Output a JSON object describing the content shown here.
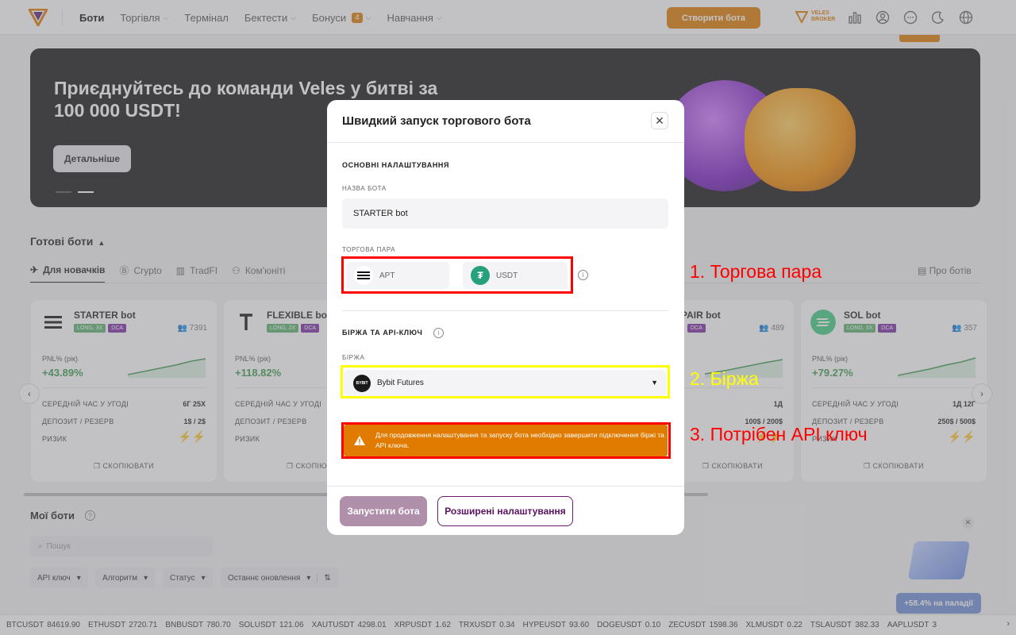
{
  "topbar": {
    "nav": [
      {
        "label": "Боти",
        "active": true,
        "chevron": false
      },
      {
        "label": "Торгівля",
        "chevron": true
      },
      {
        "label": "Термінал",
        "chevron": false
      },
      {
        "label": "Бектести",
        "chevron": true
      },
      {
        "label": "Бонуси",
        "chevron": true,
        "badge": "4"
      },
      {
        "label": "Навчання",
        "chevron": true
      }
    ],
    "create_button": "Створити бота",
    "broker_line1": "VELES",
    "broker_line2": "BROKER"
  },
  "banner": {
    "title": "Приєднуйтесь до команди Veles у битві за 100 000 USDT!",
    "button": "Детальніше"
  },
  "ready_bots": {
    "title": "Готові боти",
    "tabs": [
      "Для новачків",
      "Crypto",
      "TradFI",
      "Ком'юніті"
    ],
    "about": "Про ботів",
    "cards": [
      {
        "name": "STARTER bot",
        "tag": "LONG, 3X",
        "dca": "DCA",
        "users": "7391",
        "pnl_label": "PNL% (рік)",
        "pnl": "+43.89%",
        "avg_label": "СЕРЕДНІЙ ЧАС У УГОДІ",
        "avg": "6Г 25Х",
        "dep_label": "ДЕПОЗИТ / РЕЗЕРВ",
        "dep": "1$ / 2$",
        "risk_label": "РИЗИК",
        "copy": "СКОПІЮВАТИ"
      },
      {
        "name": "FLEXIBLE bot",
        "tag": "LONG, 2X",
        "dca": "DCA",
        "users": "",
        "pnl_label": "PNL% (рік)",
        "pnl": "+118.82%",
        "avg_label": "СЕРЕДНІЙ ЧАС У УГОДІ",
        "avg": "",
        "dep_label": "ДЕПОЗИТ / РЕЗЕРВ",
        "dep": "",
        "risk_label": "РИЗИК",
        "copy": "СКОПІЮВАТИ"
      },
      {
        "name": "PAIR bot",
        "tag": "",
        "dca": "DCA",
        "users": "489",
        "pnl_label": "",
        "pnl": "",
        "avg_label": "",
        "avg": "1Д",
        "dep_label": "",
        "dep": "100$ / 200$",
        "risk_label": "",
        "copy": "СКОПІЮВАТИ"
      },
      {
        "name": "SOL bot",
        "tag": "LONG, 3X",
        "dca": "DCA",
        "users": "357",
        "pnl_label": "PNL% (рік)",
        "pnl": "+79.27%",
        "avg_label": "СЕРЕДНІЙ ЧАС У УГОДІ",
        "avg": "1Д 12Г",
        "dep_label": "ДЕПОЗИТ / РЕЗЕРВ",
        "dep": "250$ / 500$",
        "risk_label": "РИЗИК",
        "copy": "СКОПІЮВАТИ"
      }
    ]
  },
  "my_bots": {
    "title": "Мої боти",
    "search_placeholder": "Пошук",
    "filters": [
      "API ключ",
      "Алгоритм",
      "Статус",
      "Останнє оновлення"
    ]
  },
  "promo": {
    "button": "+58.4% на паладії"
  },
  "ticker": [
    {
      "sym": "BTCUSDT",
      "val": "84619.90"
    },
    {
      "sym": "ETHUSDT",
      "val": "2720.71"
    },
    {
      "sym": "BNBUSDT",
      "val": "780.70"
    },
    {
      "sym": "SOLUSDT",
      "val": "121.06"
    },
    {
      "sym": "XAUTUSDT",
      "val": "4298.01"
    },
    {
      "sym": "XRPUSDT",
      "val": "1.62"
    },
    {
      "sym": "TRXUSDT",
      "val": "0.34"
    },
    {
      "sym": "HYPEUSDT",
      "val": "93.60"
    },
    {
      "sym": "DOGEUSDT",
      "val": "0.10"
    },
    {
      "sym": "ZECUSDT",
      "val": "1598.36"
    },
    {
      "sym": "XLMUSDT",
      "val": "0.22"
    },
    {
      "sym": "TSLAUSDT",
      "val": "382.33"
    },
    {
      "sym": "AAPLUSDT",
      "val": "3"
    }
  ],
  "modal": {
    "title": "Швидкий запуск торгового бота",
    "section_main": "ОСНОВНІ НАЛАШТУВАННЯ",
    "bot_name_label": "НАЗВА БОТА",
    "bot_name_value": "STARTER bot",
    "pair_label": "ТОРГОВА ПАРА",
    "pair_base": "APT",
    "pair_quote": "USDT",
    "section_exchange": "БІРЖА ТА API-КЛЮЧ",
    "exchange_label": "БІРЖА",
    "exchange_value": "Bybit Futures",
    "warning": "Для продовження налаштування та запуску бота необхідно завершити підключення біржі та API ключа.",
    "run_button": "Запустити бота",
    "advanced_button": "Розширені налаштування"
  },
  "annotations": {
    "a1": "1. Торгова пара",
    "a2": "2. Біржа",
    "a3": "3. Потрібен API ключ",
    "color_red": "#ff0000",
    "color_yellow": "#ffff00"
  },
  "colors": {
    "accent": "#e07b00",
    "positive": "#3a9a4d",
    "dca": "#7b2da6",
    "long": "#5bb16d"
  }
}
